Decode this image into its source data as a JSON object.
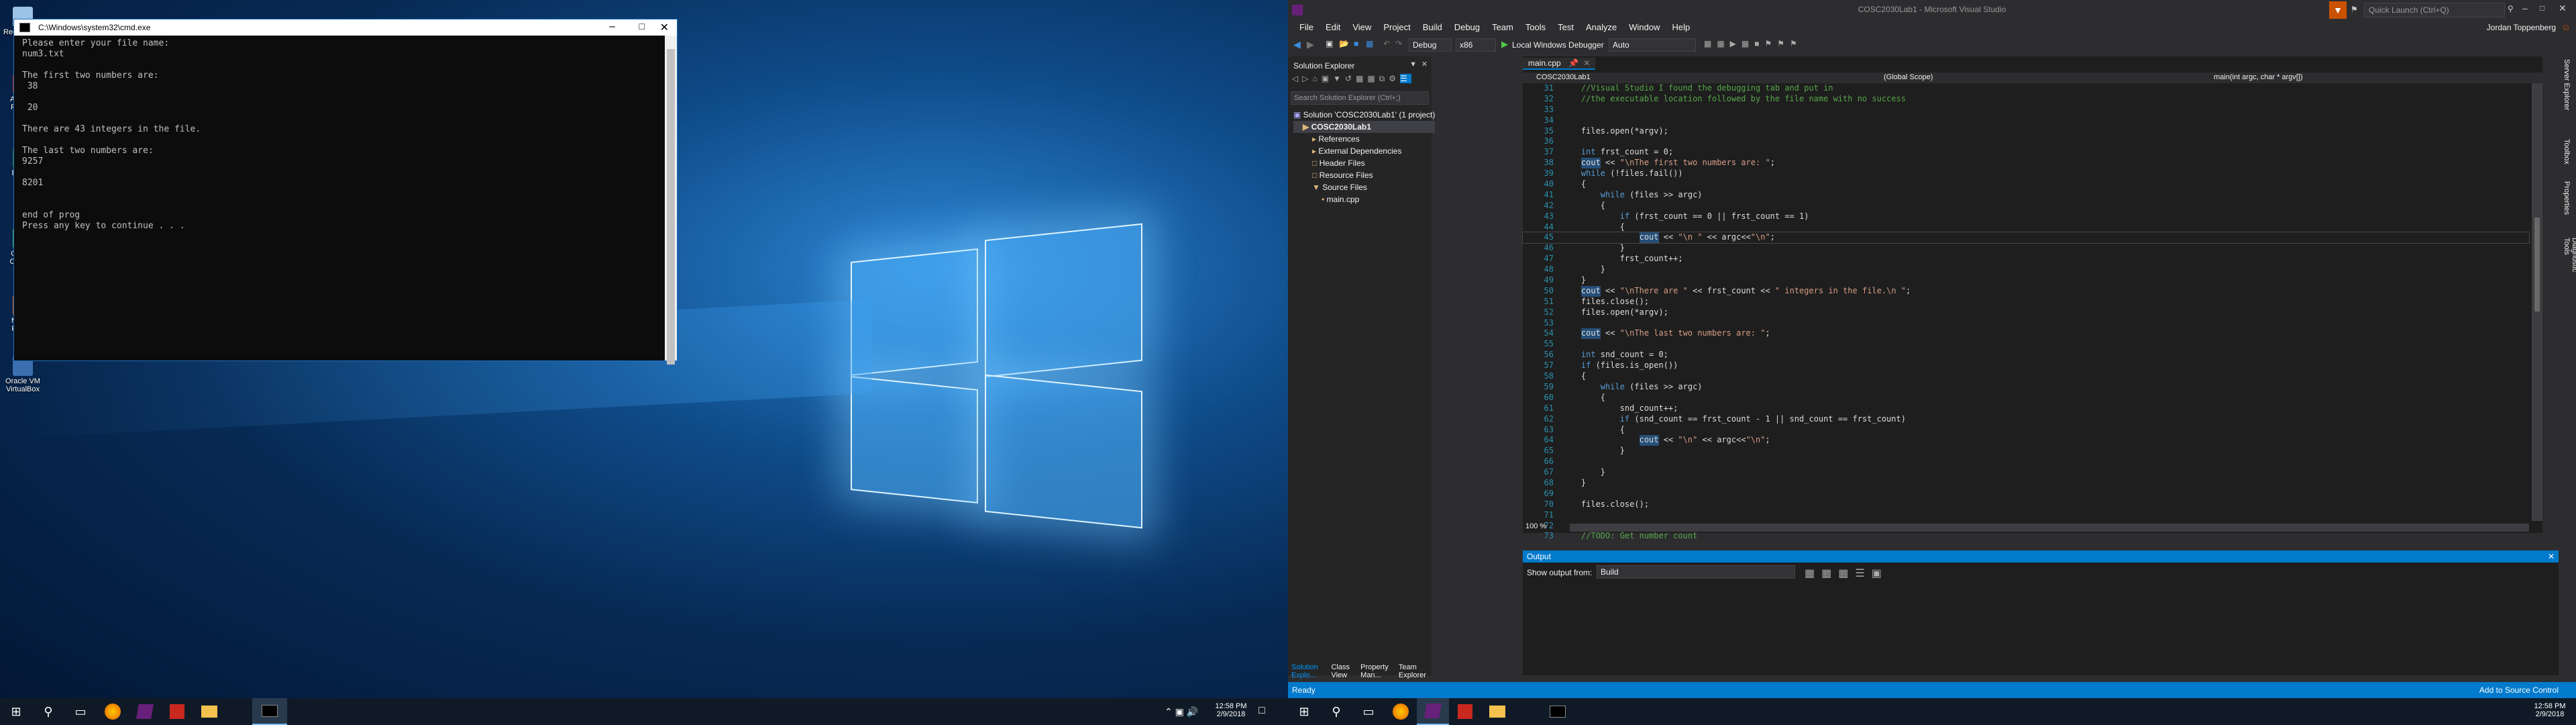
{
  "desktop1": {
    "icons": [
      {
        "label": "Recycle Bin",
        "color": "#9cc3e6"
      },
      {
        "label": "Acrobat Reader",
        "color": "#c8281e"
      },
      {
        "label": "EB201",
        "color": "#2e7d32"
      },
      {
        "label": "Google Chrome",
        "color": "#4caf50"
      },
      {
        "label": "Mozilla Firefox",
        "color": "#e66000"
      },
      {
        "label": "Oracle VM VirtualBox",
        "color": "#3a6fb0"
      }
    ]
  },
  "cmd": {
    "title": "C:\\Windows\\system32\\cmd.exe",
    "lines": [
      "Please enter your file name:",
      "num3.txt",
      "",
      "The first two numbers are:",
      " 38",
      "",
      " 20",
      "",
      "There are 43 integers in the file.",
      "",
      "The last two numbers are:",
      "9257",
      "",
      "8201",
      "",
      "",
      "end of prog",
      "Press any key to continue . . ."
    ]
  },
  "taskbar": {
    "time": "12:58 PM",
    "date": "2/9/2018",
    "icons": [
      "windows-icon",
      "search-icon",
      "taskview-icon",
      "firefox-icon",
      "visualstudio-icon",
      "acrobat-icon",
      "explorer-icon",
      "cmd-icon"
    ]
  },
  "vs": {
    "title": "COSC2030Lab1 - Microsoft Visual Studio",
    "quick_launch": "Quick Launch (Ctrl+Q)",
    "user": "Jordan Toppenberg",
    "menu": [
      "File",
      "Edit",
      "View",
      "Project",
      "Build",
      "Debug",
      "Team",
      "Tools",
      "Test",
      "Analyze",
      "Window",
      "Help"
    ],
    "toolbar": {
      "config": "Debug",
      "platform": "x86",
      "run_label": "Local Windows Debugger",
      "auto": "Auto"
    },
    "solution_explorer": {
      "title": "Solution Explorer",
      "search_placeholder": "Search Solution Explorer (Ctrl+;)",
      "tree": [
        {
          "label": "Solution 'COSC2030Lab1' (1 project)",
          "indent": 0
        },
        {
          "label": "COSC2030Lab1",
          "indent": 1
        },
        {
          "label": "References",
          "indent": 2
        },
        {
          "label": "External Dependencies",
          "indent": 2
        },
        {
          "label": "Header Files",
          "indent": 2
        },
        {
          "label": "Resource Files",
          "indent": 2
        },
        {
          "label": "Source Files",
          "indent": 2
        },
        {
          "label": "main.cpp",
          "indent": 3
        }
      ],
      "bottom_tabs": [
        "Solution Explo...",
        "Class View",
        "Property Man...",
        "Team Explorer"
      ]
    },
    "editor": {
      "tab": "main.cpp",
      "nav_project": "COSC2030Lab1",
      "nav_scope": "(Global Scope)",
      "nav_func": "main(int argc, char * argv[])",
      "zoom": "100 %",
      "lines": [
        {
          "n": "31",
          "segs": [
            [
              "cm",
              "    //Visual Studio I found the debugging tab and put in"
            ]
          ]
        },
        {
          "n": "32",
          "segs": [
            [
              "cm",
              "    //the executable location followed by the file name with no success"
            ]
          ]
        },
        {
          "n": "33",
          "segs": [
            [
              "tx",
              ""
            ]
          ]
        },
        {
          "n": "34",
          "segs": [
            [
              "tx",
              ""
            ]
          ]
        },
        {
          "n": "35",
          "segs": [
            [
              "tx",
              "    files.open(*argv);"
            ]
          ]
        },
        {
          "n": "36",
          "segs": [
            [
              "tx",
              ""
            ]
          ]
        },
        {
          "n": "37",
          "segs": [
            [
              "kw",
              "    int"
            ],
            [
              "tx",
              " frst_count = 0;"
            ]
          ]
        },
        {
          "n": "38",
          "segs": [
            [
              "hl",
              "    cout"
            ],
            [
              "tx",
              " << "
            ],
            [
              "st",
              "\"\\nThe first two numbers are: \""
            ],
            [
              "tx",
              ";"
            ]
          ]
        },
        {
          "n": "39",
          "segs": [
            [
              "kw",
              "    while"
            ],
            [
              "tx",
              " (!files.fail())"
            ]
          ]
        },
        {
          "n": "40",
          "segs": [
            [
              "tx",
              "    {"
            ]
          ]
        },
        {
          "n": "41",
          "segs": [
            [
              "kw",
              "        while"
            ],
            [
              "tx",
              " (files >> argc)"
            ]
          ]
        },
        {
          "n": "42",
          "segs": [
            [
              "tx",
              "        {"
            ]
          ]
        },
        {
          "n": "43",
          "segs": [
            [
              "kw",
              "            if"
            ],
            [
              "tx",
              " (frst_count == 0 || frst_count == 1)"
            ]
          ]
        },
        {
          "n": "44",
          "segs": [
            [
              "tx",
              "            {"
            ]
          ]
        },
        {
          "n": "45",
          "segs": [
            [
              "hl",
              "                cout"
            ],
            [
              "tx",
              " << "
            ],
            [
              "st",
              "\"\\n \""
            ],
            [
              "tx",
              " << argc<<"
            ],
            [
              "st",
              "\"\\n\""
            ],
            [
              "tx",
              ";"
            ]
          ]
        },
        {
          "n": "46",
          "segs": [
            [
              "tx",
              "            }"
            ]
          ]
        },
        {
          "n": "47",
          "segs": [
            [
              "tx",
              "            frst_count++;"
            ]
          ]
        },
        {
          "n": "48",
          "segs": [
            [
              "tx",
              "        }"
            ]
          ]
        },
        {
          "n": "49",
          "segs": [
            [
              "tx",
              "    }"
            ]
          ]
        },
        {
          "n": "50",
          "segs": [
            [
              "hl",
              "    cout"
            ],
            [
              "tx",
              " << "
            ],
            [
              "st",
              "\"\\nThere are \""
            ],
            [
              "tx",
              " << frst_count << "
            ],
            [
              "st",
              "\" integers in the file.\\n \""
            ],
            [
              "tx",
              ";"
            ]
          ]
        },
        {
          "n": "51",
          "segs": [
            [
              "tx",
              "    files.close();"
            ]
          ]
        },
        {
          "n": "52",
          "segs": [
            [
              "tx",
              "    files.open(*argv);"
            ]
          ]
        },
        {
          "n": "53",
          "segs": [
            [
              "tx",
              ""
            ]
          ]
        },
        {
          "n": "54",
          "segs": [
            [
              "hl",
              "    cout"
            ],
            [
              "tx",
              " << "
            ],
            [
              "st",
              "\"\\nThe last two numbers are: \""
            ],
            [
              "tx",
              ";"
            ]
          ]
        },
        {
          "n": "55",
          "segs": [
            [
              "tx",
              ""
            ]
          ]
        },
        {
          "n": "56",
          "segs": [
            [
              "kw",
              "    int"
            ],
            [
              "tx",
              " snd_count = 0;"
            ]
          ]
        },
        {
          "n": "57",
          "segs": [
            [
              "kw",
              "    if"
            ],
            [
              "tx",
              " (files.is_open())"
            ]
          ]
        },
        {
          "n": "58",
          "segs": [
            [
              "tx",
              "    {"
            ]
          ]
        },
        {
          "n": "59",
          "segs": [
            [
              "kw",
              "        while"
            ],
            [
              "tx",
              " (files >> argc)"
            ]
          ]
        },
        {
          "n": "60",
          "segs": [
            [
              "tx",
              "        {"
            ]
          ]
        },
        {
          "n": "61",
          "segs": [
            [
              "tx",
              "            snd_count++;"
            ]
          ]
        },
        {
          "n": "62",
          "segs": [
            [
              "kw",
              "            if"
            ],
            [
              "tx",
              " (snd_count == frst_count - 1 || snd_count == frst_count)"
            ]
          ]
        },
        {
          "n": "63",
          "segs": [
            [
              "tx",
              "            {"
            ]
          ]
        },
        {
          "n": "64",
          "segs": [
            [
              "hl",
              "                cout"
            ],
            [
              "tx",
              " << "
            ],
            [
              "st",
              "\"\\n\""
            ],
            [
              "tx",
              " << argc<<"
            ],
            [
              "st",
              "\"\\n\""
            ],
            [
              "tx",
              ";"
            ]
          ]
        },
        {
          "n": "65",
          "segs": [
            [
              "tx",
              "            }"
            ]
          ]
        },
        {
          "n": "66",
          "segs": [
            [
              "tx",
              ""
            ]
          ]
        },
        {
          "n": "67",
          "segs": [
            [
              "tx",
              "        }"
            ]
          ]
        },
        {
          "n": "68",
          "segs": [
            [
              "tx",
              "    }"
            ]
          ]
        },
        {
          "n": "69",
          "segs": [
            [
              "tx",
              ""
            ]
          ]
        },
        {
          "n": "70",
          "segs": [
            [
              "tx",
              "    files.close();"
            ]
          ]
        },
        {
          "n": "71",
          "segs": [
            [
              "tx",
              ""
            ]
          ]
        },
        {
          "n": "72",
          "segs": [
            [
              "tx",
              ""
            ]
          ]
        },
        {
          "n": "73",
          "segs": [
            [
              "cm",
              "    //TODO: Get number count"
            ]
          ]
        }
      ]
    },
    "output": {
      "title": "Output",
      "show_from_label": "Show output from:",
      "source": "Build"
    },
    "status": {
      "left": "Ready",
      "right": "Add to Source Control"
    },
    "right_sidebar": [
      "Server Explorer",
      "Toolbox",
      "Properties",
      "Diagnostic Tools"
    ]
  },
  "taskbar2": {
    "time": "12:58 PM",
    "date": "2/9/2018"
  }
}
